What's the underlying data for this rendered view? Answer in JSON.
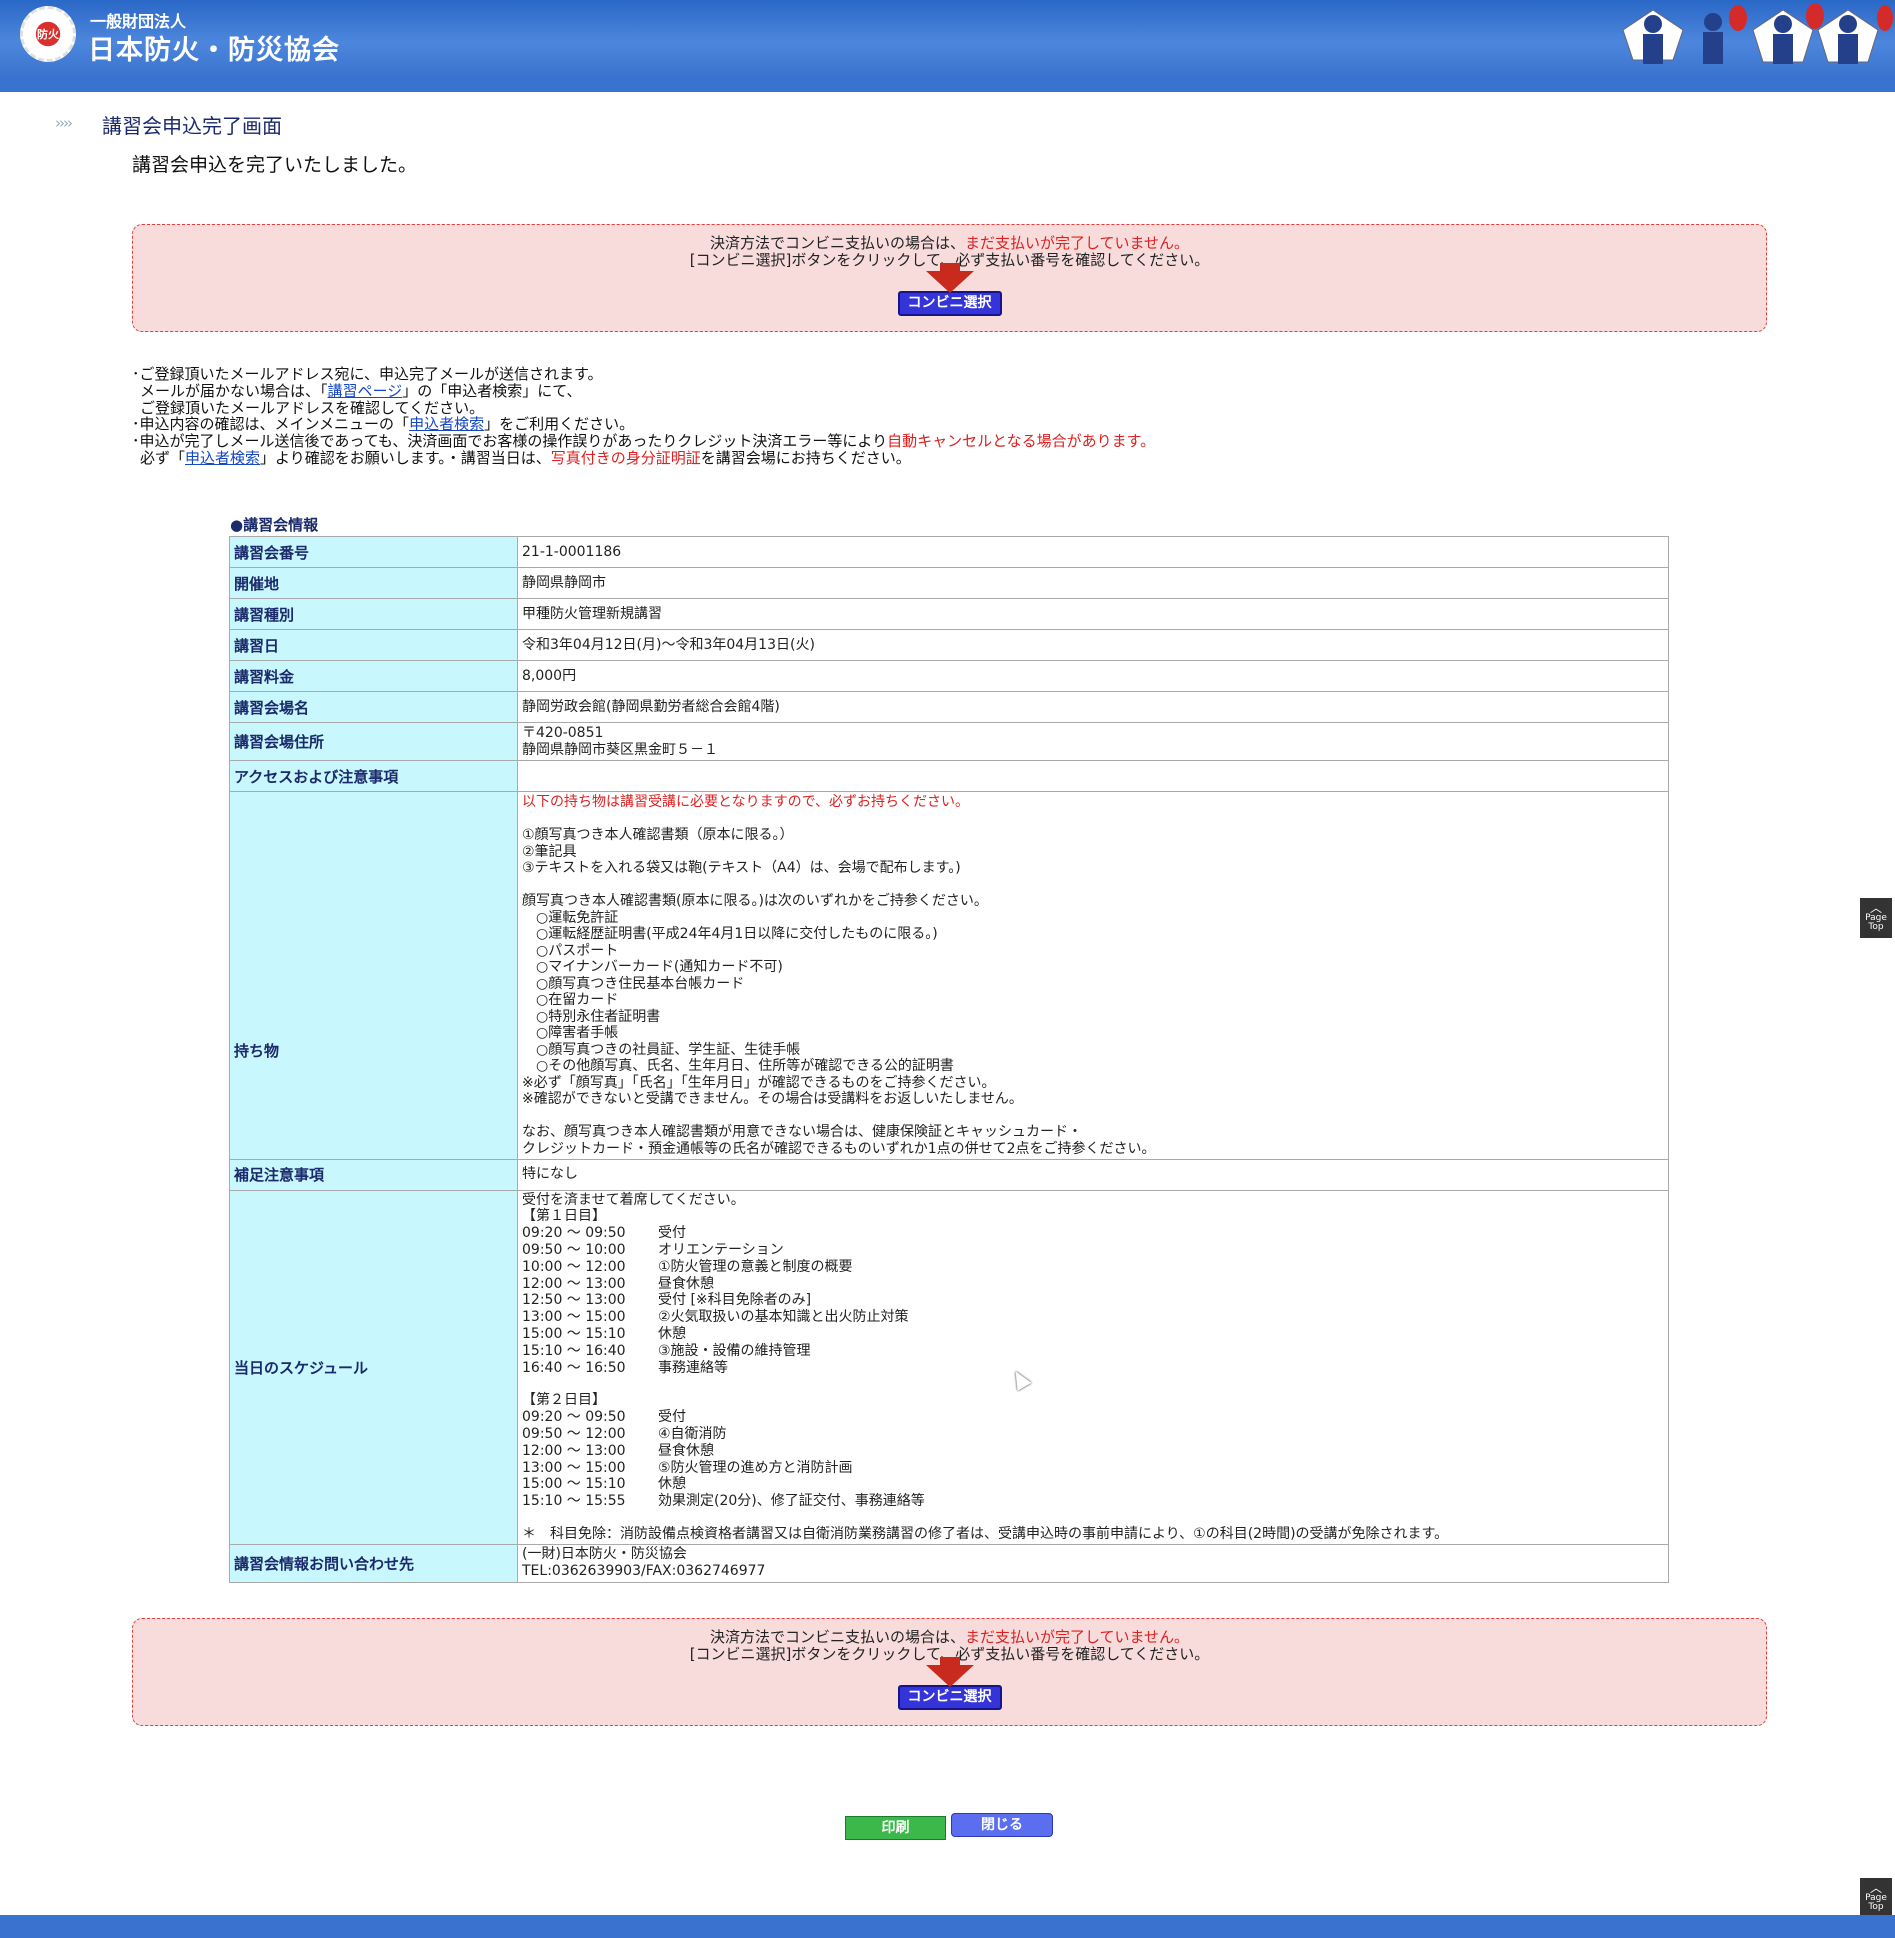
{
  "header": {
    "org_sub": "一般財団法人",
    "org_name": "日本防火・防災協会",
    "logo_text": "防火"
  },
  "page": {
    "title": "講習会申込完了画面",
    "complete_message": "講習会申込を完了いたしました。"
  },
  "notice": {
    "line1_prefix": "決済方法でコンビニ支払いの場合は、",
    "line1_red": "まだ支払いが完了していません。",
    "line2": "[コンビニ選択]ボタンをクリックして、必ず支払い番号を確認してください。",
    "button_label": "コンビニ選択"
  },
  "info": {
    "l1": "･ご登録頂いたメールアドレス宛に、申込完了メールが送信されます。",
    "l2_a": "メールが届かない場合は、「",
    "l2_link": "講習ページ",
    "l2_b": "」の「申込者検索」にて、",
    "l3": "ご登録頂いたメールアドレスを確認してください。",
    "l4_a": "･申込内容の確認は、メインメニューの「",
    "l4_link": "申込者検索",
    "l4_b": "」をご利用ください。",
    "l5_a": "･申込が完了しメール送信後であっても、決済画面でお客様の操作誤りがあったりクレジット決済エラー等により",
    "l5_red": "自動キャンセルとなる場合があります。",
    "l6_a": "必ず「",
    "l6_link": "申込者検索",
    "l6_b": "」より確認をお願いします。・講習当日は、",
    "l6_red": "写真付きの身分証明証",
    "l6_c": "を講習会場にお持ちください。"
  },
  "table": {
    "section_title": "●講習会情報",
    "rows": {
      "number": {
        "label": "講習会番号",
        "value": "21-1-0001186"
      },
      "venue_city": {
        "label": "開催地",
        "value": "静岡県静岡市"
      },
      "type": {
        "label": "講習種別",
        "value": "甲種防火管理新規講習"
      },
      "date": {
        "label": "講習日",
        "value": "令和3年04月12日(月)～令和3年04月13日(火)"
      },
      "fee": {
        "label": "講習料金",
        "value": "8,000円"
      },
      "hall": {
        "label": "講習会場名",
        "value": "静岡労政会館(静岡県勤労者総合会館4階)"
      },
      "address": {
        "label": "講習会場住所",
        "zip": "〒420-0851",
        "value": "静岡県静岡市葵区黒金町５－１"
      },
      "access": {
        "label": "アクセスおよび注意事項",
        "value": ""
      },
      "belongings": {
        "label": "持ち物",
        "red_line": "以下の持ち物は講習受講に必要となりますので、必ずお持ちください。",
        "items": "①顔写真つき本人確認書類（原本に限る。）\n②筆記具\n③テキストを入れる袋又は鞄(テキスト（A4）は、会場で配布します。)",
        "id_intro": "顔写真つき本人確認書類(原本に限る。)は次のいずれかをご持参ください。",
        "id_list": "　○運転免許証\n　○運転経歴証明書(平成24年4月1日以降に交付したものに限る。)\n　○パスポート\n　○マイナンバーカード(通知カード不可)\n　○顔写真つき住民基本台帳カード\n　○在留カード\n　○特別永住者証明書\n　○障害者手帳\n　○顔写真つきの社員証、学生証、生徒手帳\n　○その他顔写真、氏名、生年月日、住所等が確認できる公的証明書\n※必ず「顔写真」「氏名」「生年月日」が確認できるものをご持参ください。\n※確認ができないと受講できません。その場合は受講料をお返しいたしません。",
        "note": "なお、顔写真つき本人確認書類が用意できない場合は、健康保険証とキャッシュカード・\nクレジットカード・預金通帳等の氏名が確認できるものいずれか1点の併せて2点をご持参ください。"
      },
      "supplement": {
        "label": "補足注意事項",
        "value": "特になし"
      },
      "schedule": {
        "label": "当日のスケジュール",
        "intro": "受付を済ませて着席してください。",
        "day1_label": "【第１日目】",
        "day1": [
          {
            "time": "09:20 ～ 09:50",
            "item": "受付"
          },
          {
            "time": "09:50 ～ 10:00",
            "item": "オリエンテーション"
          },
          {
            "time": "10:00 ～ 12:00",
            "item": "①防火管理の意義と制度の概要"
          },
          {
            "time": "12:00 ～ 13:00",
            "item": "昼食休憩"
          },
          {
            "time": "12:50 ～ 13:00",
            "item": "受付 [※科目免除者のみ]"
          },
          {
            "time": "13:00 ～ 15:00",
            "item": "②火気取扱いの基本知識と出火防止対策"
          },
          {
            "time": "15:00 ～ 15:10",
            "item": "休憩"
          },
          {
            "time": "15:10 ～ 16:40",
            "item": "③施設・設備の維持管理"
          },
          {
            "time": "16:40 ～ 16:50",
            "item": "事務連絡等"
          }
        ],
        "day2_label": "【第２日目】",
        "day2": [
          {
            "time": "09:20 ～ 09:50",
            "item": "受付"
          },
          {
            "time": "09:50 ～ 12:00",
            "item": "④自衛消防"
          },
          {
            "time": "12:00 ～ 13:00",
            "item": "昼食休憩"
          },
          {
            "time": "13:00 ～ 15:00",
            "item": "⑤防火管理の進め方と消防計画"
          },
          {
            "time": "15:00 ～ 15:10",
            "item": "休憩"
          },
          {
            "time": "15:10 ～ 15:55",
            "item": "効果測定(20分)、修了証交付、事務連絡等"
          }
        ],
        "footnote": "＊　科目免除：消防設備点検資格者講習又は自衛消防業務講習の修了者は、受講申込時の事前申請により、①の科目(2時間)の受講が免除されます。"
      },
      "contact": {
        "label": "講習会情報お問い合わせ先",
        "org": "(一財)日本防火・防災協会",
        "tel": "TEL:0362639903/FAX:0362746977"
      }
    }
  },
  "buttons": {
    "print": "印刷",
    "close": "閉じる"
  },
  "page_top": {
    "line1": "Page",
    "line2": "Top"
  },
  "colors": {
    "header_blue": "#3a72d0",
    "label_bg": "#c8f7fd",
    "notice_bg": "#f8dcdc",
    "alert_red": "#e02020"
  }
}
